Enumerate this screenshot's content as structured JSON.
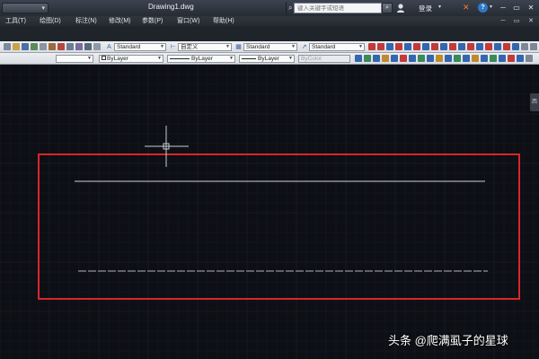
{
  "title_bar": {
    "document_title": "Drawing1.dwg",
    "search_placeholder": "键入关键字或短语",
    "signin_label": "登录",
    "quick_access_caret": "▾",
    "help_caret": "▾",
    "signin_caret": "▾",
    "window_buttons": [
      "─",
      "▭",
      "✕"
    ]
  },
  "menu_bar": {
    "items": [
      "工具(T)",
      "绘图(D)",
      "标注(N)",
      "修改(M)",
      "参数(P)",
      "窗口(W)",
      "帮助(H)"
    ],
    "doc_controls": [
      "─",
      "▭",
      "✕"
    ]
  },
  "toolbar_styles": {
    "text_style": "Standard",
    "dim_style": "自定义",
    "table_style": "Standard",
    "multileader_style": "Standard"
  },
  "toolbar_properties": {
    "color": "ByLayer",
    "linetype": "ByLayer",
    "lineweight": "ByLayer",
    "plot_style": "ByColor"
  },
  "canvas": {
    "background_color": "#0d0f14",
    "grid_color": "#1a1e26",
    "selection_rect_color": "#d8262b",
    "line_color": "#cfd2d6",
    "dashed_line_color": "#aeb2b8",
    "crosshair_color": "#c9ccd1",
    "viewcube_tab_label": "西"
  },
  "watermark": {
    "text": "头条 @爬满虱子的星球"
  }
}
